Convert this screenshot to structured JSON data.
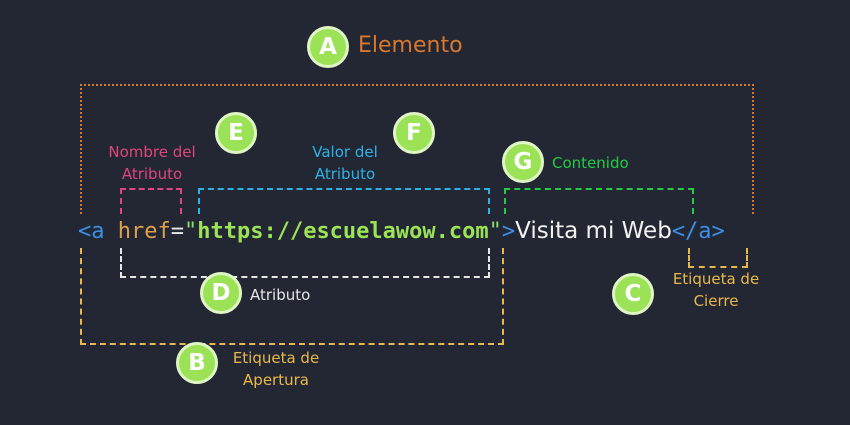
{
  "colors": {
    "background": "#222733",
    "badge_fill": "#9be256",
    "elemento": "#d8782e",
    "apertura": "#e8b84a",
    "atributo": "#e6e6e6",
    "nombre_atributo": "#e0457f",
    "valor_atributo": "#2db2e6",
    "contenido": "#22cc44",
    "cierre": "#e8b84a"
  },
  "code": {
    "open_bracket": "<a ",
    "attr_name": "href",
    "equals": "=",
    "quote_open": "\"",
    "url": "https://escuelawow.com",
    "quote_close": "\"",
    "close_bracket": ">",
    "content": "Visita mi Web",
    "closing_tag": "</a>"
  },
  "parts": [
    {
      "letter": "A",
      "label": "Elemento"
    },
    {
      "letter": "B",
      "label_line1": "Etiqueta de",
      "label_line2": "Apertura"
    },
    {
      "letter": "C",
      "label_line1": "Etiqueta de",
      "label_line2": "Cierre"
    },
    {
      "letter": "D",
      "label": "Atributo"
    },
    {
      "letter": "E",
      "label_line1": "Nombre del",
      "label_line2": "Atributo"
    },
    {
      "letter": "F",
      "label_line1": "Valor del",
      "label_line2": "Atributo"
    },
    {
      "letter": "G",
      "label": "Contenido"
    }
  ]
}
